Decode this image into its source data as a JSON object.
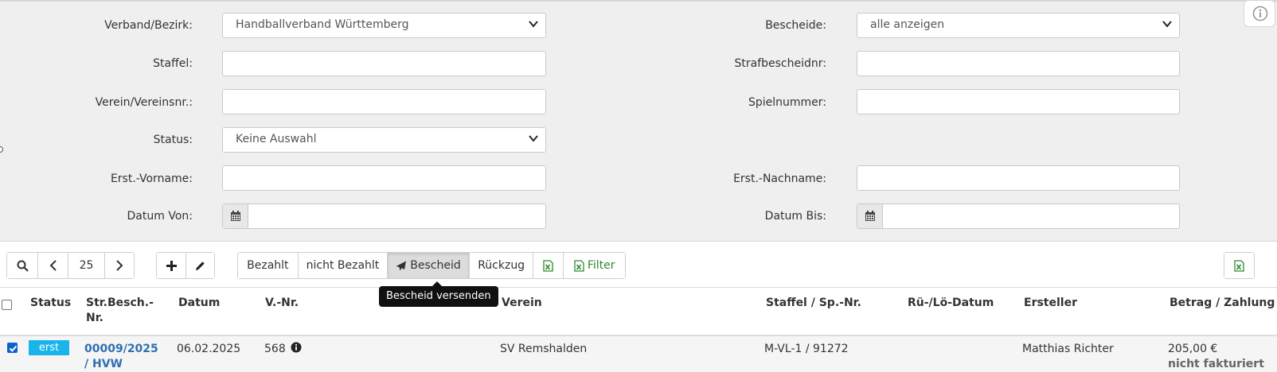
{
  "filters": {
    "verband_label": "Verband/Bezirk:",
    "verband_value": "Handballverband Württemberg",
    "bescheide_label": "Bescheide:",
    "bescheide_value": "alle anzeigen",
    "staffel_label": "Staffel:",
    "staffel_value": "",
    "strafbescheidnr_label": "Strafbescheidnr:",
    "strafbescheidnr_value": "",
    "verein_label": "Verein/Vereinsnr.:",
    "verein_value": "",
    "spielnummer_label": "Spielnummer:",
    "spielnummer_value": "",
    "status_label": "Status:",
    "status_value": "Keine Auswahl",
    "ersteller_vorname_label": "Erst.-Vorname:",
    "ersteller_vorname_value": "",
    "ersteller_nachname_label": "Erst.-Nachname:",
    "ersteller_nachname_value": "",
    "datum_von_label": "Datum Von:",
    "datum_von_value": "",
    "datum_bis_label": "Datum Bis:",
    "datum_bis_value": ""
  },
  "toolbar": {
    "page_size": "25",
    "bezahlt": "Bezahlt",
    "nicht_bezahlt": "nicht Bezahlt",
    "bescheid": "Bescheid",
    "rueckzug": "Rückzug",
    "filter": "Filter",
    "tooltip": "Bescheid versenden"
  },
  "table": {
    "headers": {
      "status": "Status",
      "str_besch_nr_1": "Str.Besch.-",
      "str_besch_nr_2": "Nr.",
      "datum": "Datum",
      "v_nr": "V.-Nr.",
      "verein": "Verein",
      "staffel": "Staffel / Sp.-Nr.",
      "rue_loe_datum": "Rü-/Lö-Datum",
      "ersteller": "Ersteller",
      "betrag": "Betrag / Zahlung"
    },
    "rows": [
      {
        "status": "erst",
        "nr_line1": "00009/2025",
        "nr_line2": "/ HVW",
        "datum": "06.02.2025",
        "v_nr": "568",
        "verein": "SV Remshalden",
        "staffel": "M-VL-1 / 91272",
        "rue_loe_datum": "",
        "ersteller": "Matthias Richter",
        "betrag": "205,00 €",
        "zahlung": "nicht fakturiert"
      }
    ]
  },
  "colors": {
    "panel_bg": "#efefef",
    "status_badge": "#18b4ea",
    "link": "#2f6fb0",
    "excel_green": "#2e8b2e",
    "checkbox_checked": "#0b63d0"
  }
}
